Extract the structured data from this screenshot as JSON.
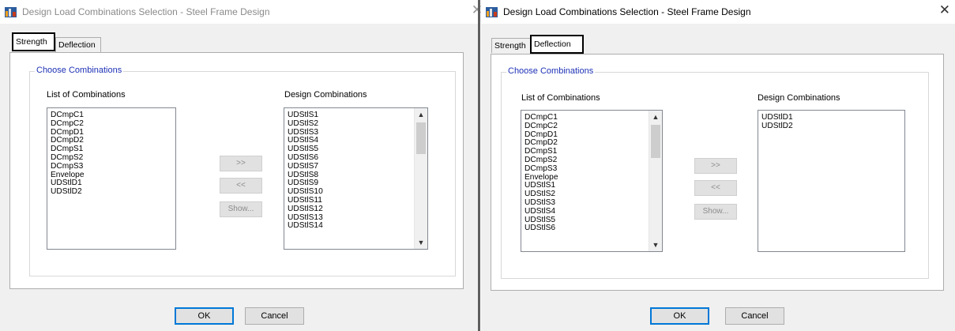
{
  "left_dialog": {
    "title": "Design Load Combinations Selection - Steel Frame Design",
    "tabs": [
      "Strength",
      "Deflection"
    ],
    "active_tab": "Strength",
    "group_title": "Choose Combinations",
    "list_label": "List of Combinations",
    "design_label": "Design Combinations",
    "list_items": [
      "DCmpC1",
      "DCmpC2",
      "DCmpD1",
      "DCmpD2",
      "DCmpS1",
      "DCmpS2",
      "DCmpS3",
      "Envelope",
      "UDStlD1",
      "UDStlD2"
    ],
    "design_items": [
      "UDStlS1",
      "UDStlS2",
      "UDStlS3",
      "UDStlS4",
      "UDStlS5",
      "UDStlS6",
      "UDStlS7",
      "UDStlS8",
      "UDStlS9",
      "UDStlS10",
      "UDStlS11",
      "UDStlS12",
      "UDStlS13",
      "UDStlS14"
    ],
    "buttons": {
      "add": ">>",
      "remove": "<<",
      "show": "Show...",
      "ok": "OK",
      "cancel": "Cancel"
    }
  },
  "right_dialog": {
    "title": "Design Load Combinations Selection - Steel Frame Design",
    "tabs": [
      "Strength",
      "Deflection"
    ],
    "active_tab": "Deflection",
    "group_title": "Choose Combinations",
    "list_label": "List of Combinations",
    "design_label": "Design Combinations",
    "list_items": [
      "DCmpC1",
      "DCmpC2",
      "DCmpD1",
      "DCmpD2",
      "DCmpS1",
      "DCmpS2",
      "DCmpS3",
      "Envelope",
      "UDStlS1",
      "UDStlS2",
      "UDStlS3",
      "UDStlS4",
      "UDStlS5",
      "UDStlS6"
    ],
    "design_items": [
      "UDStlD1",
      "UDStlD2"
    ],
    "buttons": {
      "add": ">>",
      "remove": "<<",
      "show": "Show...",
      "ok": "OK",
      "cancel": "Cancel"
    }
  },
  "icons": {
    "app": "app-icon",
    "close": "close-icon",
    "scroll_up": "scroll-up-arrow-icon",
    "scroll_down": "scroll-down-arrow-icon"
  },
  "colors": {
    "group_title": "#1d31b5",
    "default_button_border": "#0078d7",
    "dialog_bg": "#f0f0f0"
  }
}
